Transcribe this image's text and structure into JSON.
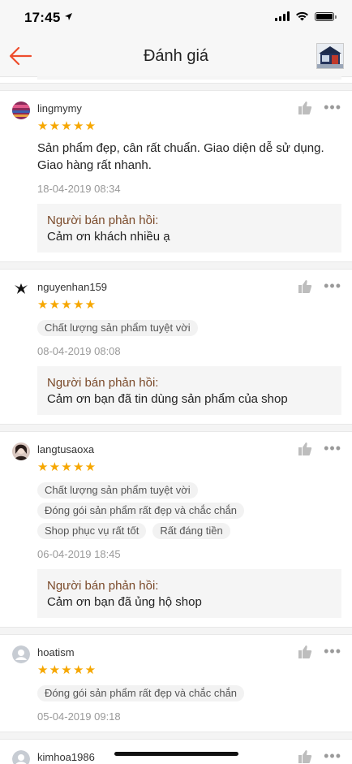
{
  "status_bar": {
    "time": "17:45"
  },
  "header": {
    "title": "Đánh giá"
  },
  "reviews": [
    {
      "username": "lingmymy",
      "stars": "★★★★★",
      "comment": "Sản phẩm đẹp, cân rất chuẩn. Giao diện dễ sử dụng. Giao hàng rất nhanh.",
      "date": "18-04-2019 08:34",
      "reply_label": "Người bán phản hồi:",
      "reply_text": "Cảm ơn khách nhiều ạ"
    },
    {
      "username": "nguyenhan159",
      "stars": "★★★★★",
      "tags": [
        "Chất lượng sản phẩm tuyệt vời"
      ],
      "date": "08-04-2019 08:08",
      "reply_label": "Người bán phản hồi:",
      "reply_text": "Cảm ơn bạn đã tin dùng sản phẩm của shop"
    },
    {
      "username": "langtusaoxa",
      "stars": "★★★★★",
      "tags": [
        "Chất lượng sản phẩm tuyệt vời",
        "Đóng gói sản phẩm rất đẹp và chắc chắn",
        "Shop phục vụ rất tốt",
        "Rất đáng tiền"
      ],
      "date": "06-04-2019 18:45",
      "reply_label": "Người bán phản hồi:",
      "reply_text": "Cảm ơn bạn đã ủng hộ shop"
    },
    {
      "username": "hoatism",
      "stars": "★★★★★",
      "tags": [
        "Đóng gói sản phẩm rất đẹp và chắc chắn"
      ],
      "date": "05-04-2019 09:18"
    },
    {
      "username": "kimhoa1986",
      "stars": "★★★★★"
    }
  ],
  "icons": {
    "like": "thumbs-up-icon",
    "more": "more-dots-icon",
    "back": "back-arrow-icon"
  },
  "colors": {
    "accent": "#ee4d2d",
    "star": "#f6a700",
    "reply_label": "#7a4a2a"
  }
}
